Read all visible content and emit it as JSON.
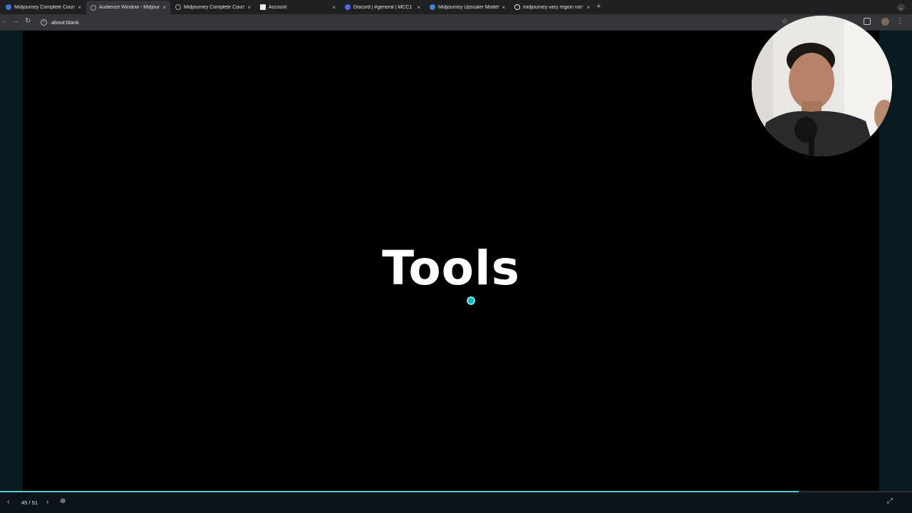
{
  "browser": {
    "tabs": [
      {
        "label": "Midjourney Complete Course",
        "favicon": "shield-icon",
        "color": "#3b73d9",
        "active": false
      },
      {
        "label": "Audience Window - Midjourney",
        "favicon": "globe-icon",
        "color": "#9aa0a6",
        "active": true
      },
      {
        "label": "Midjourney Complete Course",
        "favicon": "globe-icon",
        "color": "#9aa0a6",
        "active": false
      },
      {
        "label": "Account",
        "favicon": "document-icon",
        "color": "#e8eaed",
        "active": false
      },
      {
        "label": "Discord | #general | MCC1",
        "favicon": "discord-icon",
        "color": "#5865f2",
        "active": false
      },
      {
        "label": "Midjourney Upscaler Models",
        "favicon": "midjourney-icon",
        "color": "#4a7fd4",
        "active": false
      },
      {
        "label": "midjourney vary region not working",
        "favicon": "google-icon",
        "color": "#e8eaed",
        "active": false
      }
    ],
    "new_tab": "+",
    "url": "about:blank"
  },
  "slide": {
    "title": "Tools"
  },
  "player": {
    "counter": "45 / 51",
    "progress": 0.876
  },
  "colors": {
    "accent": "#4fd1d9",
    "cursor": "#1fb5b5",
    "background": "#000000"
  }
}
